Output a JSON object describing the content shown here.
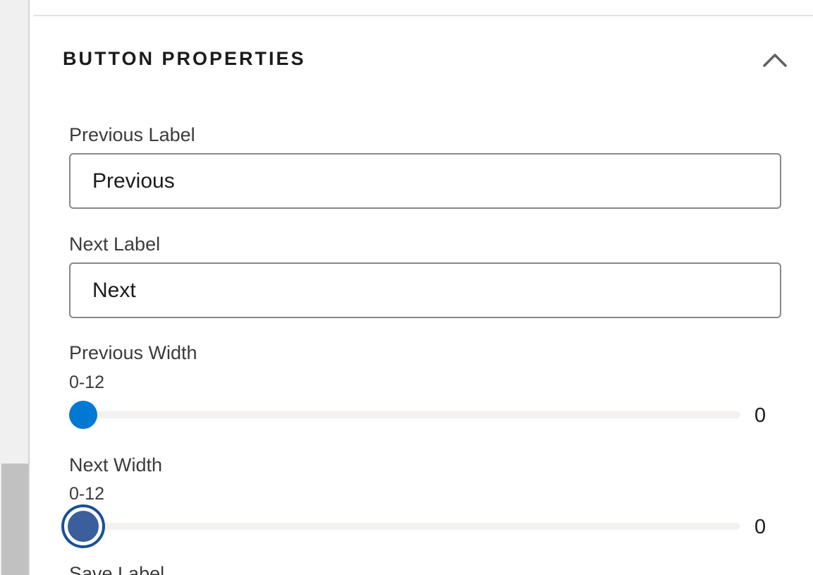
{
  "section": {
    "title": "BUTTON PROPERTIES",
    "collapse_icon": "chevron-up-icon"
  },
  "fields": {
    "previous_label": {
      "label": "Previous Label",
      "value": "Previous"
    },
    "next_label": {
      "label": "Next Label",
      "value": "Next"
    }
  },
  "sliders": {
    "previous_width": {
      "label": "Previous Width",
      "range_hint": "0-12",
      "min": 0,
      "max": 12,
      "value": "0"
    },
    "next_width": {
      "label": "Next Width",
      "range_hint": "0-12",
      "min": 0,
      "max": 12,
      "value": "0"
    }
  },
  "next_field_partial": {
    "label": "Save Label"
  },
  "colors": {
    "accent": "#0078d4",
    "focused_thumb": "#3a5f9a",
    "focus_ring": "#1a4f95"
  }
}
